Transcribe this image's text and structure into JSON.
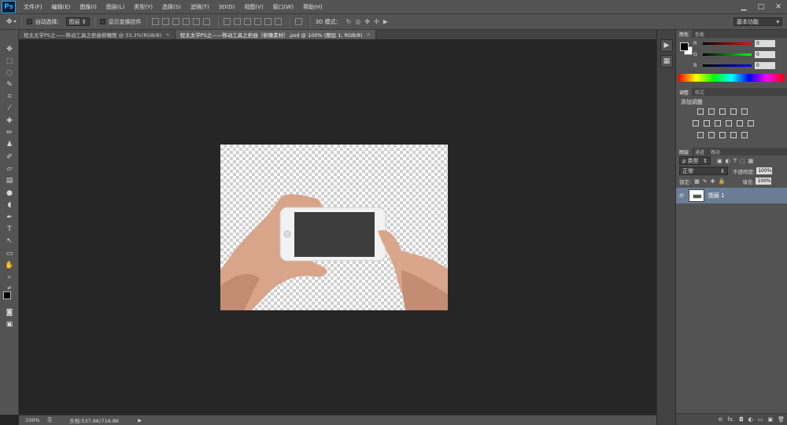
{
  "app": {
    "logo": "Ps"
  },
  "menu": [
    "文件(F)",
    "编辑(E)",
    "图像(I)",
    "图层(L)",
    "类型(Y)",
    "选择(S)",
    "滤镜(T)",
    "3D(D)",
    "视图(V)",
    "窗口(W)",
    "帮助(H)"
  ],
  "window_controls": {
    "minimize": "▁",
    "maximize": "□",
    "close": "✕"
  },
  "options": {
    "auto_select_label": "自动选择：",
    "auto_select_value": "图层",
    "show_transform_label": "显示变换控件",
    "mode_3d_label": "3D 模式：",
    "workspace": "基本功能"
  },
  "tabs": [
    {
      "label": "程太太学PS之——移动工具之拒曲俯瞰图 @ 33.3%(RGB/8)",
      "close": "×",
      "active": false
    },
    {
      "label": "程太太学PS之——移动工具之拒曲（俯瞰素材）.psd @ 100% (图层 1, RGB/8)",
      "close": "×",
      "active": true
    }
  ],
  "status": {
    "zoom": "100%",
    "doc_info": "文档:537.6K/716.8K",
    "arrow": "▶"
  },
  "color_panel": {
    "tabs": [
      "颜色",
      "色板"
    ],
    "channels": [
      {
        "label": "R",
        "value": "0"
      },
      {
        "label": "G",
        "value": "0"
      },
      {
        "label": "B",
        "value": "0"
      }
    ]
  },
  "adjust_panel": {
    "tabs": [
      "调整",
      "样式"
    ],
    "title": "添加调整"
  },
  "layers_panel": {
    "tabs": [
      "图层",
      "通道",
      "路径"
    ],
    "filter_kind": "ρ 类型",
    "blend_mode": "正常",
    "opacity_label": "不透明度:",
    "opacity_value": "100%",
    "lock_label": "锁定:",
    "fill_label": "填充:",
    "fill_value": "100%",
    "layers": [
      {
        "name": "图层 1",
        "visible_icon": "👁"
      }
    ],
    "footer_icons": [
      "⊖",
      "fx.",
      "◘",
      "◐",
      "▭",
      "▣",
      "🗑"
    ]
  },
  "colors": {
    "accent": "#31a8ff",
    "selected_layer": "#6a7d94"
  }
}
